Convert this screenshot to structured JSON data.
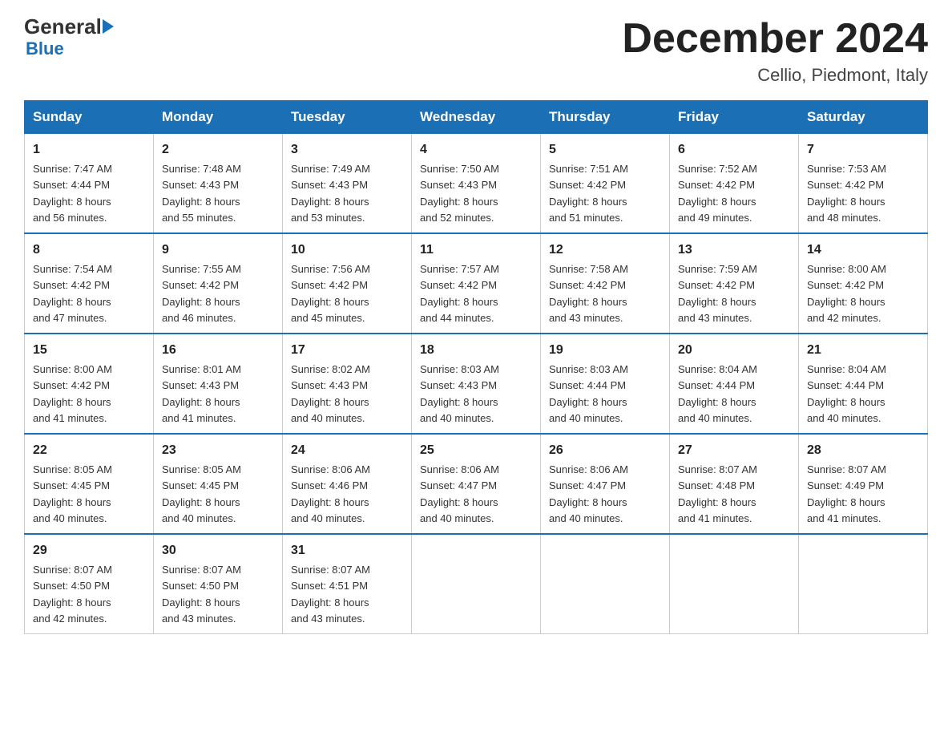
{
  "header": {
    "logo_general": "General",
    "logo_blue": "Blue",
    "title": "December 2024",
    "subtitle": "Cellio, Piedmont, Italy"
  },
  "days_of_week": [
    "Sunday",
    "Monday",
    "Tuesday",
    "Wednesday",
    "Thursday",
    "Friday",
    "Saturday"
  ],
  "weeks": [
    [
      {
        "num": "1",
        "sunrise": "7:47 AM",
        "sunset": "4:44 PM",
        "daylight": "8 hours and 56 minutes."
      },
      {
        "num": "2",
        "sunrise": "7:48 AM",
        "sunset": "4:43 PM",
        "daylight": "8 hours and 55 minutes."
      },
      {
        "num": "3",
        "sunrise": "7:49 AM",
        "sunset": "4:43 PM",
        "daylight": "8 hours and 53 minutes."
      },
      {
        "num": "4",
        "sunrise": "7:50 AM",
        "sunset": "4:43 PM",
        "daylight": "8 hours and 52 minutes."
      },
      {
        "num": "5",
        "sunrise": "7:51 AM",
        "sunset": "4:42 PM",
        "daylight": "8 hours and 51 minutes."
      },
      {
        "num": "6",
        "sunrise": "7:52 AM",
        "sunset": "4:42 PM",
        "daylight": "8 hours and 49 minutes."
      },
      {
        "num": "7",
        "sunrise": "7:53 AM",
        "sunset": "4:42 PM",
        "daylight": "8 hours and 48 minutes."
      }
    ],
    [
      {
        "num": "8",
        "sunrise": "7:54 AM",
        "sunset": "4:42 PM",
        "daylight": "8 hours and 47 minutes."
      },
      {
        "num": "9",
        "sunrise": "7:55 AM",
        "sunset": "4:42 PM",
        "daylight": "8 hours and 46 minutes."
      },
      {
        "num": "10",
        "sunrise": "7:56 AM",
        "sunset": "4:42 PM",
        "daylight": "8 hours and 45 minutes."
      },
      {
        "num": "11",
        "sunrise": "7:57 AM",
        "sunset": "4:42 PM",
        "daylight": "8 hours and 44 minutes."
      },
      {
        "num": "12",
        "sunrise": "7:58 AM",
        "sunset": "4:42 PM",
        "daylight": "8 hours and 43 minutes."
      },
      {
        "num": "13",
        "sunrise": "7:59 AM",
        "sunset": "4:42 PM",
        "daylight": "8 hours and 43 minutes."
      },
      {
        "num": "14",
        "sunrise": "8:00 AM",
        "sunset": "4:42 PM",
        "daylight": "8 hours and 42 minutes."
      }
    ],
    [
      {
        "num": "15",
        "sunrise": "8:00 AM",
        "sunset": "4:42 PM",
        "daylight": "8 hours and 41 minutes."
      },
      {
        "num": "16",
        "sunrise": "8:01 AM",
        "sunset": "4:43 PM",
        "daylight": "8 hours and 41 minutes."
      },
      {
        "num": "17",
        "sunrise": "8:02 AM",
        "sunset": "4:43 PM",
        "daylight": "8 hours and 40 minutes."
      },
      {
        "num": "18",
        "sunrise": "8:03 AM",
        "sunset": "4:43 PM",
        "daylight": "8 hours and 40 minutes."
      },
      {
        "num": "19",
        "sunrise": "8:03 AM",
        "sunset": "4:44 PM",
        "daylight": "8 hours and 40 minutes."
      },
      {
        "num": "20",
        "sunrise": "8:04 AM",
        "sunset": "4:44 PM",
        "daylight": "8 hours and 40 minutes."
      },
      {
        "num": "21",
        "sunrise": "8:04 AM",
        "sunset": "4:44 PM",
        "daylight": "8 hours and 40 minutes."
      }
    ],
    [
      {
        "num": "22",
        "sunrise": "8:05 AM",
        "sunset": "4:45 PM",
        "daylight": "8 hours and 40 minutes."
      },
      {
        "num": "23",
        "sunrise": "8:05 AM",
        "sunset": "4:45 PM",
        "daylight": "8 hours and 40 minutes."
      },
      {
        "num": "24",
        "sunrise": "8:06 AM",
        "sunset": "4:46 PM",
        "daylight": "8 hours and 40 minutes."
      },
      {
        "num": "25",
        "sunrise": "8:06 AM",
        "sunset": "4:47 PM",
        "daylight": "8 hours and 40 minutes."
      },
      {
        "num": "26",
        "sunrise": "8:06 AM",
        "sunset": "4:47 PM",
        "daylight": "8 hours and 40 minutes."
      },
      {
        "num": "27",
        "sunrise": "8:07 AM",
        "sunset": "4:48 PM",
        "daylight": "8 hours and 41 minutes."
      },
      {
        "num": "28",
        "sunrise": "8:07 AM",
        "sunset": "4:49 PM",
        "daylight": "8 hours and 41 minutes."
      }
    ],
    [
      {
        "num": "29",
        "sunrise": "8:07 AM",
        "sunset": "4:50 PM",
        "daylight": "8 hours and 42 minutes."
      },
      {
        "num": "30",
        "sunrise": "8:07 AM",
        "sunset": "4:50 PM",
        "daylight": "8 hours and 43 minutes."
      },
      {
        "num": "31",
        "sunrise": "8:07 AM",
        "sunset": "4:51 PM",
        "daylight": "8 hours and 43 minutes."
      },
      null,
      null,
      null,
      null
    ]
  ],
  "labels": {
    "sunrise": "Sunrise:",
    "sunset": "Sunset:",
    "daylight": "Daylight:"
  }
}
